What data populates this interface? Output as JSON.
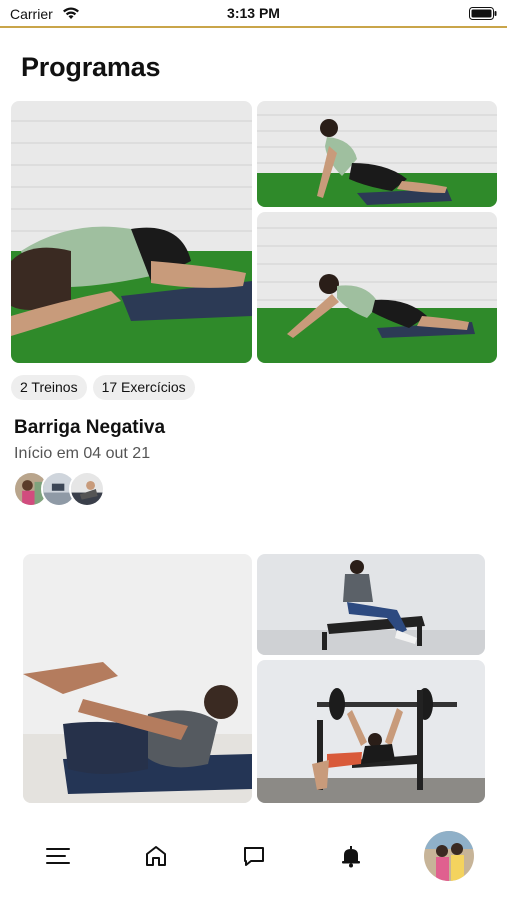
{
  "status_bar": {
    "carrier": "Carrier",
    "time": "3:13 PM",
    "wifi_icon": "wifi-icon",
    "battery_icon": "battery-icon"
  },
  "page": {
    "title": "Programas"
  },
  "programs": [
    {
      "stats": [
        "2 Treinos",
        "17 Exercícios"
      ],
      "name": "Barriga Negativa",
      "start": "Início em 04 out 21",
      "images": [
        "stretch-child-pose-photo",
        "stretch-sitting-photo",
        "stretch-reach-photo"
      ],
      "avatar_count": 3
    },
    {
      "images": [
        "crunch-photo",
        "bench-seated-photo",
        "bench-press-photo"
      ]
    }
  ],
  "tab_bar": {
    "items": [
      {
        "icon": "menu-icon"
      },
      {
        "icon": "home-icon"
      },
      {
        "icon": "chat-icon"
      },
      {
        "icon": "bell-icon"
      },
      {
        "icon": "profile-avatar"
      }
    ]
  },
  "colors": {
    "accent_line": "#c9a54a",
    "chip_bg": "#eeeeee",
    "grass": "#2f8a2a",
    "wall": "#e8e8e8"
  }
}
